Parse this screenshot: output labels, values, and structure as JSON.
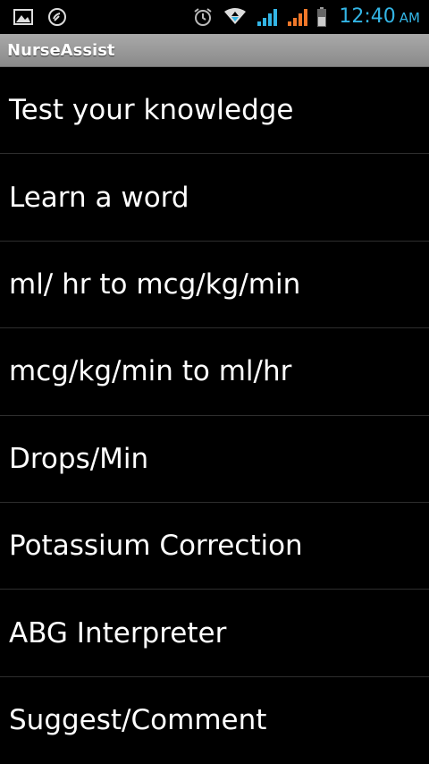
{
  "status_bar": {
    "time": "12:40",
    "ampm": "AM",
    "icons": [
      "gallery-icon",
      "phone-call-icon",
      "alarm-icon",
      "data-arrows-icon",
      "signal-blue-icon",
      "signal-orange-icon",
      "battery-icon"
    ],
    "accent_color": "#33b5e5"
  },
  "app": {
    "title": "NurseAssist"
  },
  "menu": {
    "items": [
      {
        "label": "Test your knowledge"
      },
      {
        "label": "Learn a word"
      },
      {
        "label": "ml/ hr to mcg/kg/min"
      },
      {
        "label": "mcg/kg/min to ml/hr"
      },
      {
        "label": "Drops/Min"
      },
      {
        "label": "Potassium Correction"
      },
      {
        "label": "ABG Interpreter"
      },
      {
        "label": "Suggest/Comment"
      }
    ]
  }
}
